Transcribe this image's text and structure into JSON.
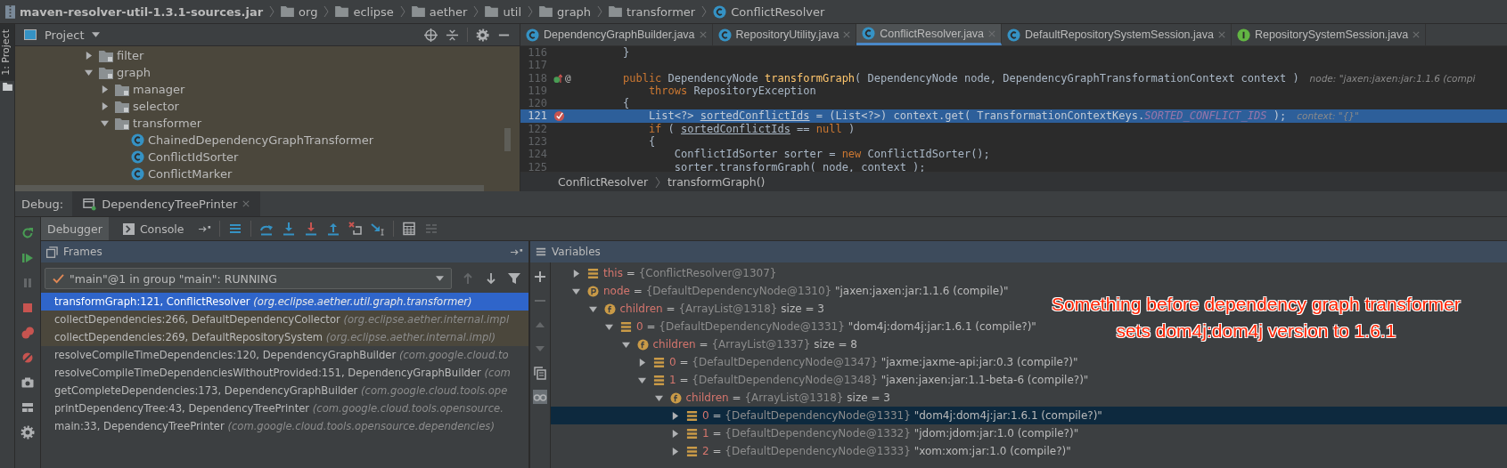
{
  "breadcrumbs": [
    {
      "label": "maven-resolver-util-1.3.1-sources.jar",
      "kind": "jar"
    },
    {
      "label": "org",
      "kind": "folder"
    },
    {
      "label": "eclipse",
      "kind": "folder"
    },
    {
      "label": "aether",
      "kind": "folder"
    },
    {
      "label": "util",
      "kind": "folder"
    },
    {
      "label": "graph",
      "kind": "folder"
    },
    {
      "label": "transformer",
      "kind": "folder"
    },
    {
      "label": "ConflictResolver",
      "kind": "class"
    }
  ],
  "left_stripe": {
    "label": "1: Project"
  },
  "project": {
    "title": "Project",
    "tree": [
      {
        "label": "filter",
        "kind": "folder",
        "expanded": false
      },
      {
        "label": "graph",
        "kind": "folder",
        "expanded": true,
        "children": [
          {
            "label": "manager",
            "kind": "folder",
            "expanded": false
          },
          {
            "label": "selector",
            "kind": "folder",
            "expanded": false
          },
          {
            "label": "transformer",
            "kind": "folder",
            "expanded": true,
            "children": [
              {
                "label": "ChainedDependencyGraphTransformer",
                "kind": "class"
              },
              {
                "label": "ConflictIdSorter",
                "kind": "class"
              },
              {
                "label": "ConflictMarker",
                "kind": "class"
              }
            ]
          }
        ]
      }
    ]
  },
  "editor": {
    "tabs": [
      {
        "label": "DependencyGraphBuilder.java",
        "kind": "class",
        "selected": false
      },
      {
        "label": "RepositoryUtility.java",
        "kind": "class",
        "selected": false
      },
      {
        "label": "ConflictResolver.java",
        "kind": "class",
        "selected": true
      },
      {
        "label": "DefaultRepositorySystemSession.java",
        "kind": "class",
        "selected": false
      },
      {
        "label": "RepositorySystemSession.java",
        "kind": "interface",
        "selected": false
      }
    ],
    "lines": [
      {
        "number": "116",
        "current": false,
        "segments": [
          {
            "text": "}",
            "kind": "plain"
          }
        ]
      },
      {
        "number": "117",
        "current": false
      },
      {
        "number": "118",
        "current": false,
        "marker": {
          "kind": "override"
        },
        "gutter_text": "@",
        "segments": [
          {
            "text": "public ",
            "kind": "keyword"
          },
          {
            "text": "DependencyNode ",
            "kind": "plain"
          },
          {
            "text": "transformGraph",
            "kind": "declaration"
          },
          {
            "text": "( DependencyNode node, DependencyGraphTransformationContext context )",
            "kind": "plain"
          },
          {
            "text": "node: \"jaxen:jaxen:jar:1.1.6 (compi",
            "kind": "hint"
          }
        ]
      },
      {
        "number": "119",
        "current": false,
        "segments": [
          {
            "text": "    throws ",
            "kind": "keyword"
          },
          {
            "text": "RepositoryException",
            "kind": "plain"
          }
        ]
      },
      {
        "number": "120",
        "current": false,
        "segments": [
          {
            "text": "{",
            "kind": "plain"
          }
        ]
      },
      {
        "number": "121",
        "current": true,
        "marker": {
          "kind": "breakpoint"
        },
        "segments": [
          {
            "text": "    List<?> ",
            "kind": "plain"
          },
          {
            "text": "sortedConflictIds",
            "kind": "underlined"
          },
          {
            "text": " = (List<?>) context.get( TransformationContextKeys.",
            "kind": "plain"
          },
          {
            "text": "SORTED_CONFLICT_IDS",
            "kind": "constant"
          },
          {
            "text": " );",
            "kind": "plain"
          },
          {
            "text": "context: \"{}\"",
            "kind": "hint"
          }
        ]
      },
      {
        "number": "122",
        "current": false,
        "segments": [
          {
            "text": "    if",
            "kind": "keyword"
          },
          {
            "text": " ( ",
            "kind": "plain"
          },
          {
            "text": "sortedConflictIds",
            "kind": "underlined"
          },
          {
            "text": " == ",
            "kind": "plain"
          },
          {
            "text": "null",
            "kind": "keyword"
          },
          {
            "text": " )",
            "kind": "plain"
          }
        ]
      },
      {
        "number": "123",
        "current": false,
        "segments": [
          {
            "text": "    {",
            "kind": "plain"
          }
        ]
      },
      {
        "number": "124",
        "current": false,
        "segments": [
          {
            "text": "        ConflictIdSorter sorter = ",
            "kind": "plain"
          },
          {
            "text": "new ",
            "kind": "keyword"
          },
          {
            "text": "ConflictIdSorter();",
            "kind": "plain"
          }
        ]
      },
      {
        "number": "125",
        "current": false,
        "segments": [
          {
            "text": "        sorter.transformGraph( node, context );",
            "kind": "plain"
          }
        ]
      }
    ],
    "breadcrumb": [
      "ConflictResolver",
      "transformGraph()"
    ]
  },
  "debug": {
    "label": "Debug:",
    "session": "DependencyTreePrinter",
    "tabs": [
      {
        "label": "Debugger",
        "kind": "debugger",
        "selected": true
      },
      {
        "label": "Console",
        "kind": "console",
        "selected": false
      }
    ],
    "toolbar_buttons": [
      {
        "kind": "lines",
        "disabled": false
      },
      {
        "kind": "stepover",
        "disabled": false
      },
      {
        "kind": "stepinto",
        "disabled": false
      },
      {
        "kind": "forceinto",
        "disabled": false
      },
      {
        "kind": "stepout",
        "disabled": false
      },
      {
        "kind": "dropframe",
        "disabled": false
      },
      {
        "kind": "runcursor",
        "disabled": false
      },
      {
        "kind": "calculator",
        "disabled": false
      },
      {
        "kind": "trace",
        "disabled": true
      }
    ],
    "side_buttons": [
      {
        "kind": "rerun",
        "disabled": false
      },
      {
        "kind": "resume",
        "disabled": false
      },
      {
        "kind": "pause",
        "disabled": true
      },
      {
        "kind": "stop",
        "disabled": false
      },
      {
        "kind": "breakpoints",
        "disabled": false
      },
      {
        "kind": "mute",
        "disabled": false
      },
      {
        "kind": "camera",
        "disabled": false
      },
      {
        "kind": "layout",
        "disabled": false
      },
      {
        "kind": "settings",
        "disabled": false
      }
    ],
    "frames": {
      "title": "Frames",
      "thread": "\"main\"@1 in group \"main\": RUNNING",
      "buttons": [
        {
          "kind": "up",
          "disabled": true
        },
        {
          "kind": "down",
          "disabled": false
        },
        {
          "kind": "filter",
          "disabled": false
        }
      ],
      "items": [
        {
          "method": "transformGraph:121, ConflictResolver",
          "package": "(org.eclipse.aether.util.graph.transformer)",
          "selected": true,
          "library": false
        },
        {
          "method": "collectDependencies:266, DefaultDependencyCollector",
          "package": "(org.eclipse.aether.internal.impl",
          "selected": false,
          "library": true
        },
        {
          "method": "collectDependencies:269, DefaultRepositorySystem",
          "package": "(org.eclipse.aether.internal.impl)",
          "selected": false,
          "library": true
        },
        {
          "method": "resolveCompileTimeDependencies:120, DependencyGraphBuilder",
          "package": "(com.google.cloud.to",
          "selected": false,
          "library": false
        },
        {
          "method": "resolveCompileTimeDependenciesWithoutProvided:151, DependencyGraphBuilder",
          "package": "(com",
          "selected": false,
          "library": false
        },
        {
          "method": "getCompleteDependencies:173, DependencyGraphBuilder",
          "package": "(com.google.cloud.tools.ope",
          "selected": false,
          "library": false
        },
        {
          "method": "printDependencyTree:43, DependencyTreePrinter",
          "package": "(com.google.cloud.tools.opensource.",
          "selected": false,
          "library": false
        },
        {
          "method": "main:33, DependencyTreePrinter",
          "package": "(com.google.cloud.tools.opensource.dependencies)",
          "selected": false,
          "library": false
        }
      ]
    },
    "variables": {
      "title": "Variables",
      "buttons": [
        {
          "kind": "add",
          "disabled": false,
          "selected": false
        },
        {
          "kind": "remove",
          "disabled": true,
          "selected": false
        },
        {
          "kind": "moveup",
          "disabled": true,
          "selected": false
        },
        {
          "kind": "movedown",
          "disabled": true,
          "selected": false
        },
        {
          "kind": "copy",
          "disabled": false,
          "selected": false
        },
        {
          "kind": "glasses",
          "disabled": false,
          "selected": true
        }
      ],
      "tree": [
        {
          "name": "this",
          "op": "=",
          "value": "{ConflictResolver@1307}",
          "kind": "object",
          "expanded": false,
          "selected": false
        },
        {
          "name": "node",
          "op": "=",
          "value": "{DefaultDependencyNode@1310}",
          "detail": "\"jaxen:jaxen:jar:1.1.6 (compile)\"",
          "kind": "param",
          "expanded": true,
          "selected": false,
          "children": [
            {
              "name": "children",
              "op": "=",
              "value": "{ArrayList@1318}",
              "detail": "size = 3",
              "kind": "field",
              "expanded": true,
              "selected": false,
              "children": [
                {
                  "name": "0",
                  "op": "=",
                  "value": "{DefaultDependencyNode@1331}",
                  "detail": "\"dom4j:dom4j:jar:1.6.1 (compile?)\"",
                  "kind": "object",
                  "expanded": true,
                  "selected": false,
                  "children": [
                    {
                      "name": "children",
                      "op": "=",
                      "value": "{ArrayList@1337}",
                      "detail": "size = 8",
                      "kind": "field",
                      "expanded": true,
                      "selected": false,
                      "children": [
                        {
                          "name": "0",
                          "op": "=",
                          "value": "{DefaultDependencyNode@1347}",
                          "detail": "\"jaxme:jaxme-api:jar:0.3 (compile?)\"",
                          "kind": "object",
                          "expanded": false,
                          "selected": false
                        },
                        {
                          "name": "1",
                          "op": "=",
                          "value": "{DefaultDependencyNode@1348}",
                          "detail": "\"jaxen:jaxen:jar:1.1-beta-6 (compile?)\"",
                          "kind": "object",
                          "expanded": true,
                          "selected": false,
                          "children": [
                            {
                              "name": "children",
                              "op": "=",
                              "value": "{ArrayList@1318}",
                              "detail": "size = 3",
                              "kind": "field",
                              "expanded": true,
                              "selected": false,
                              "children": [
                                {
                                  "name": "0",
                                  "op": "=",
                                  "value": "{DefaultDependencyNode@1331}",
                                  "detail": "\"dom4j:dom4j:jar:1.6.1 (compile?)\"",
                                  "kind": "object",
                                  "expanded": false,
                                  "selected": true
                                },
                                {
                                  "name": "1",
                                  "op": "=",
                                  "value": "{DefaultDependencyNode@1332}",
                                  "detail": "\"jdom:jdom:jar:1.0 (compile?)\"",
                                  "kind": "object",
                                  "expanded": false,
                                  "selected": false
                                },
                                {
                                  "name": "2",
                                  "op": "=",
                                  "value": "{DefaultDependencyNode@1333}",
                                  "detail": "\"xom:xom:jar:1.0 (compile?)\"",
                                  "kind": "object",
                                  "expanded": false,
                                  "selected": false
                                }
                              ]
                            }
                          ]
                        }
                      ]
                    }
                  ]
                }
              ]
            }
          ]
        }
      ]
    },
    "annotation": [
      "Something before dependency graph transformer",
      "sets dom4j:dom4j version to 1.6.1"
    ]
  }
}
